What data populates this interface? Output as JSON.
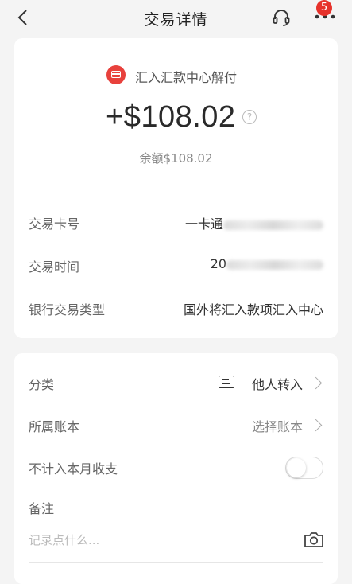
{
  "header": {
    "title": "交易详情",
    "badge_count": "5"
  },
  "summary": {
    "source_label": "汇入汇款中心解付",
    "amount": "+$108.02",
    "help_glyph": "?",
    "balance": "余额$108.02"
  },
  "details": [
    {
      "label": "交易卡号",
      "value": "一卡通"
    },
    {
      "label": "交易时间",
      "value": "20"
    },
    {
      "label": "银行交易类型",
      "value": "国外将汇入款项汇入中心"
    }
  ],
  "settings": {
    "category_label": "分类",
    "category_value": "他人转入",
    "account_label": "所属账本",
    "account_value": "选择账本",
    "exclude_label": "不计入本月收支",
    "exclude_enabled": false,
    "note_label": "备注",
    "note_placeholder": "记录点什么..."
  },
  "colors": {
    "accent": "#e6322b",
    "background": "#f4f4f4",
    "card": "#ffffff"
  },
  "icons": [
    "back-icon",
    "headset-icon",
    "more-icon",
    "card-icon",
    "help-icon",
    "category-icon",
    "chevron-right-icon",
    "camera-icon"
  ]
}
